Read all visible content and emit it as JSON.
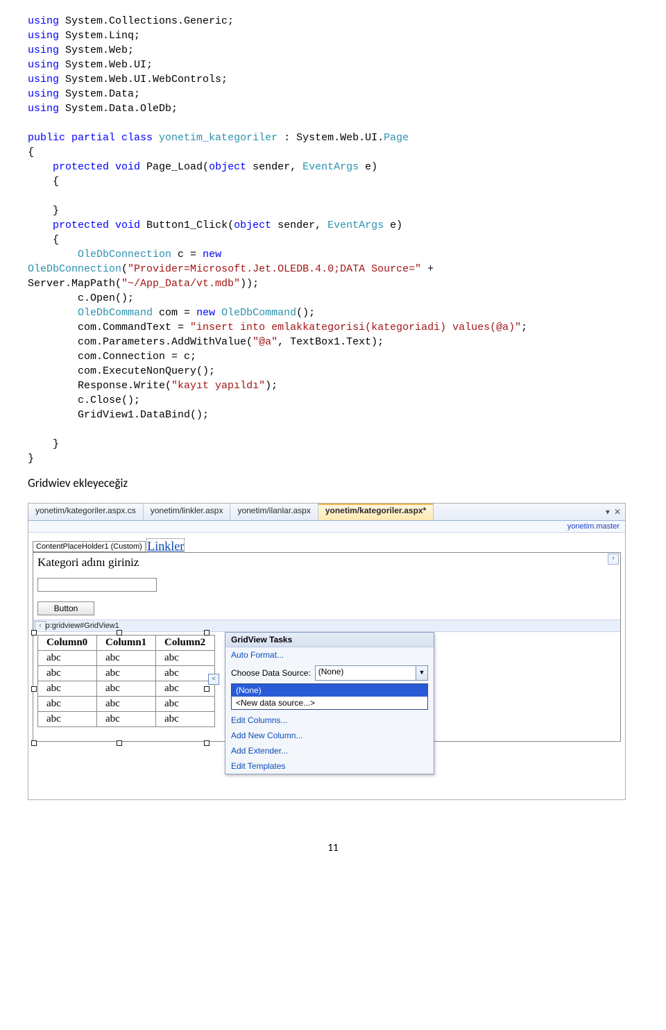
{
  "code": {
    "using": [
      "System.Collections.Generic",
      "System.Linq",
      "System.Web",
      "System.Web.UI",
      "System.Web.UI.WebControls",
      "System.Data",
      "System.Data.OleDb"
    ],
    "classdecl_pre": "public partial class ",
    "classname": "yonetim_kategoriler",
    "classdecl_post": " : System.Web.UI.",
    "pagecls": "Page",
    "pageload_pre": "    protected void Page_Load(object sender, ",
    "eventargs": "EventArgs",
    "pageload_post": " e)",
    "btnclick_pre": "    protected void Button1_Click(object sender, ",
    "btnclick_post": " e)",
    "oledbconn": "OleDbConnection",
    "newkw": "new",
    "connstr1": "\"Provider=Microsoft.Jet.OLEDB.4.0;DATA Source=\"",
    "connstr2": "\"~/App_Data/vt.mdb\"",
    "oledbcmd": "OleDbCommand",
    "cmdtext": "\"insert into emlakkategorisi(kategoriadi) values(@a)\"",
    "paramname": "\"@a\"",
    "respmsg": "\"kayıt yapıldı\""
  },
  "heading": "Gridwiev ekleyeceğiz",
  "ide": {
    "tabs": [
      "yonetim/kategoriler.aspx.cs",
      "yonetim/linkler.aspx",
      "yonetim/ilanlar.aspx",
      "yonetim/kategoriler.aspx*"
    ],
    "active_tab": 3,
    "masterfile": "yonetim.master",
    "cph_label": "ContentPlaceHolder1 (Custom)",
    "linkler": "Linkler",
    "kategori_label": "Kategori adını giriniz",
    "button_label": "Button",
    "tagline": "asp:gridview#GridView1",
    "grid": {
      "cols": [
        "Column0",
        "Column1",
        "Column2"
      ],
      "rows": [
        [
          "abc",
          "abc",
          "abc"
        ],
        [
          "abc",
          "abc",
          "abc"
        ],
        [
          "abc",
          "abc",
          "abc"
        ],
        [
          "abc",
          "abc",
          "abc"
        ],
        [
          "abc",
          "abc",
          "abc"
        ]
      ]
    },
    "smarttag": {
      "title": "GridView Tasks",
      "autoformat": "Auto Format...",
      "choose_ds_label": "Choose Data Source:",
      "choose_ds_value": "(None)",
      "options": [
        "(None)",
        "<New data source...>"
      ],
      "editcols": "Edit Columns...",
      "addcol": "Add New Column...",
      "addext": "Add Extender...",
      "edittmpl": "Edit Templates"
    }
  },
  "pagenum": "11"
}
